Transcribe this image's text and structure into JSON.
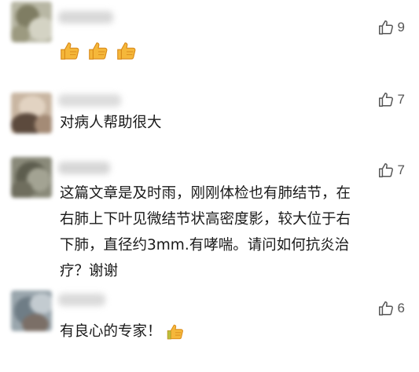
{
  "comments": [
    {
      "text": "",
      "like_count": "9",
      "emojis": [
        "thumbs-up-emoji",
        "thumbs-up-emoji",
        "thumbs-up-emoji"
      ]
    },
    {
      "text": "对病人帮助很大",
      "like_count": "7"
    },
    {
      "text": "这篇文章是及时雨，刚刚体检也有肺结节，在\n右肺上下叶见微结节状高密度影，较大位于右\n下肺，直径约3mm.有哮喘。请问如何抗炎治\n疗？谢谢",
      "like_count": "7"
    },
    {
      "text": "有良心的专家！",
      "like_count": "6",
      "emojis": [
        "thumbs-up-emoji"
      ]
    }
  ],
  "icons": {
    "like": "thumbs-up-outline-icon",
    "emoji": "thumbs-up-emoji"
  },
  "colors": {
    "like_icon": "#555555",
    "emoji_fill": "#f5b73a",
    "emoji_outline": "#d98a1a",
    "text": "#1a1a1a"
  }
}
